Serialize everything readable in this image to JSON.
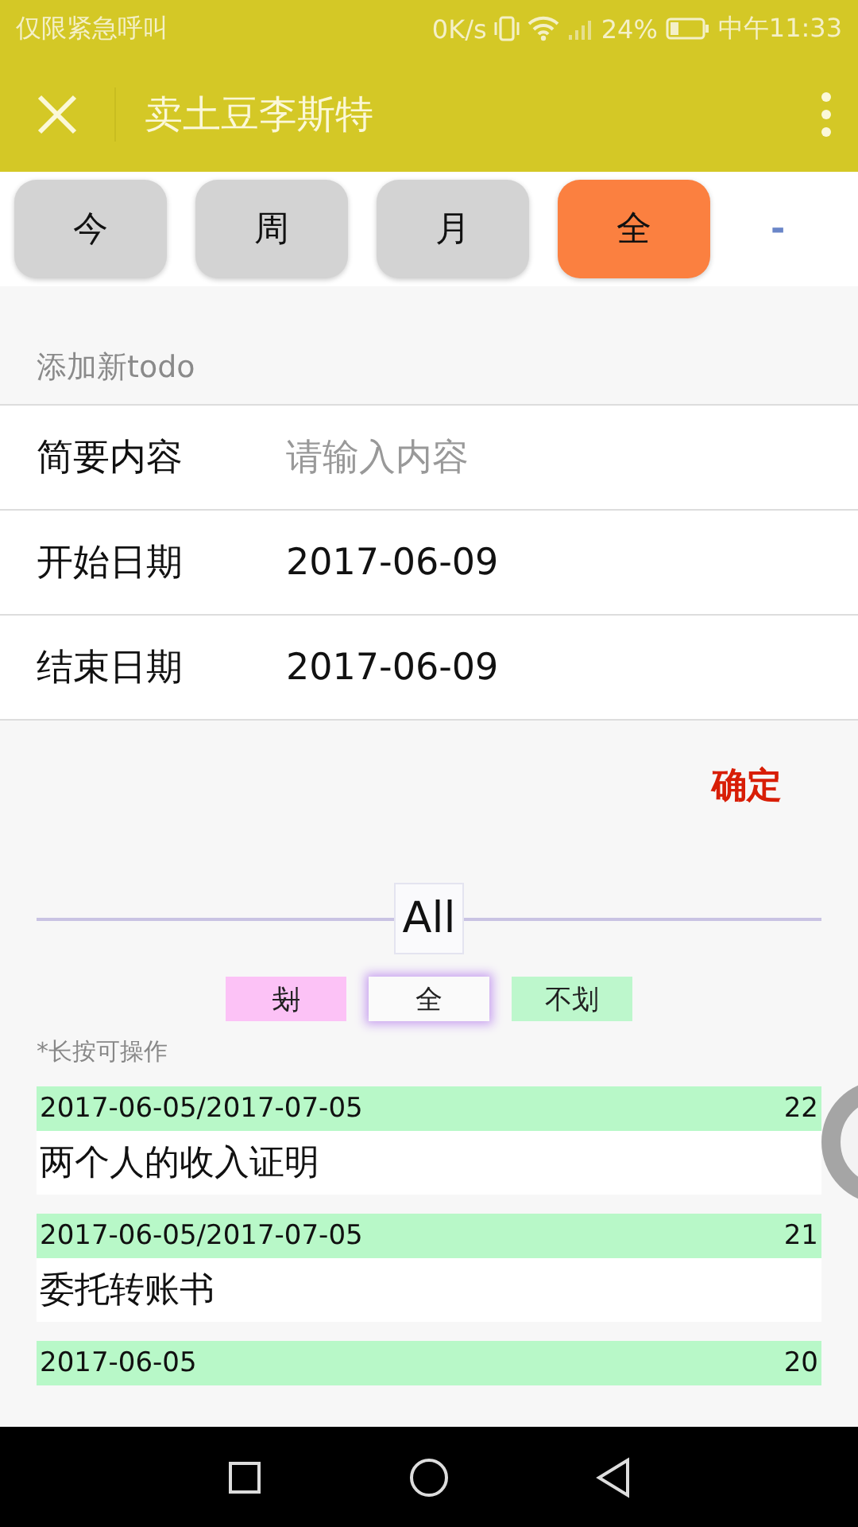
{
  "status_bar": {
    "carrier": "仅限紧急呼叫",
    "speed": "0K/s",
    "battery": "24%",
    "time": "中午11:33"
  },
  "header": {
    "title": "卖土豆李斯特"
  },
  "tabs": [
    {
      "label": "今",
      "selected": false
    },
    {
      "label": "周",
      "selected": false
    },
    {
      "label": "月",
      "selected": false
    },
    {
      "label": "全",
      "selected": true
    }
  ],
  "tabs_extra": "-",
  "form": {
    "section_title": "添加新todo",
    "fields": [
      {
        "label": "简要内容",
        "placeholder": "请输入内容"
      },
      {
        "label": "开始日期",
        "value": "2017-06-09"
      },
      {
        "label": "结束日期",
        "value": "2017-06-09"
      }
    ],
    "submit": "确定"
  },
  "filter": {
    "heading": "All",
    "options": [
      {
        "label": "划",
        "kind": "struck",
        "selected": false
      },
      {
        "label": "全",
        "kind": "all",
        "selected": true
      },
      {
        "label": "不划",
        "kind": "open",
        "selected": false
      }
    ],
    "hint": "*长按可操作"
  },
  "todos": [
    {
      "dates": "2017-06-05/2017-07-05",
      "count": "22",
      "title": "两个人的收入证明"
    },
    {
      "dates": "2017-06-05/2017-07-05",
      "count": "21",
      "title": "委托转账书"
    },
    {
      "dates": "2017-06-05",
      "count": "20"
    }
  ]
}
